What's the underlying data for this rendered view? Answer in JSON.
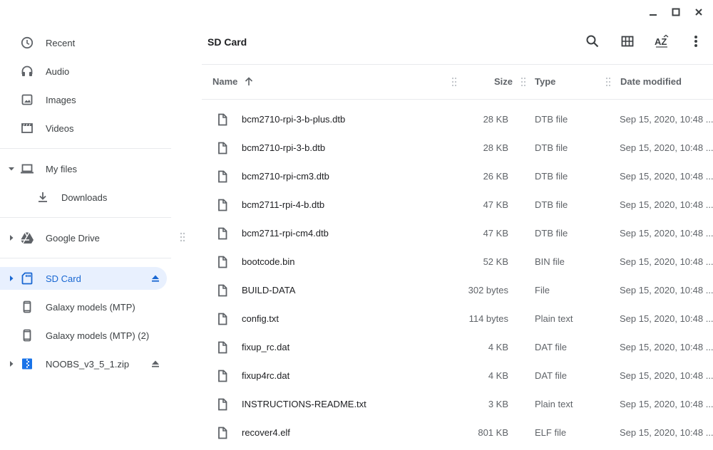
{
  "window": {
    "minimize_icon": "minimize-icon",
    "maximize_icon": "maximize-icon",
    "close_icon": "close-icon"
  },
  "sidebar": {
    "recent": {
      "label": "Recent",
      "icon": "clock-icon"
    },
    "audio": {
      "label": "Audio",
      "icon": "headphones-icon"
    },
    "images": {
      "label": "Images",
      "icon": "image-icon"
    },
    "videos": {
      "label": "Videos",
      "icon": "film-icon"
    },
    "my_files": {
      "label": "My files",
      "icon": "laptop-icon"
    },
    "downloads": {
      "label": "Downloads",
      "icon": "download-icon"
    },
    "google_drive": {
      "label": "Google Drive",
      "icon": "drive-icon"
    },
    "sd_card": {
      "label": "SD Card",
      "icon": "sd-card-icon"
    },
    "galaxy_1": {
      "label": "Galaxy models (MTP)",
      "icon": "phone-icon"
    },
    "galaxy_2": {
      "label": "Galaxy models (MTP) (2)",
      "icon": "phone-icon"
    },
    "noobs": {
      "label": "NOOBS_v3_5_1.zip",
      "icon": "zip-archive-icon"
    }
  },
  "header": {
    "title": "SD Card",
    "toolbar": [
      "search-icon",
      "grid-view-icon",
      "sort-az-icon",
      "more-vert-icon"
    ]
  },
  "table": {
    "columns": {
      "name": "Name",
      "size": "Size",
      "type": "Type",
      "date": "Date modified"
    },
    "sort": "name-ascending",
    "rows": [
      {
        "name": "bcm2710-rpi-3-b-plus.dtb",
        "size": "28 KB",
        "type": "DTB file",
        "date": "Sep 15, 2020, 10:48 ..."
      },
      {
        "name": "bcm2710-rpi-3-b.dtb",
        "size": "28 KB",
        "type": "DTB file",
        "date": "Sep 15, 2020, 10:48 ..."
      },
      {
        "name": "bcm2710-rpi-cm3.dtb",
        "size": "26 KB",
        "type": "DTB file",
        "date": "Sep 15, 2020, 10:48 ..."
      },
      {
        "name": "bcm2711-rpi-4-b.dtb",
        "size": "47 KB",
        "type": "DTB file",
        "date": "Sep 15, 2020, 10:48 ..."
      },
      {
        "name": "bcm2711-rpi-cm4.dtb",
        "size": "47 KB",
        "type": "DTB file",
        "date": "Sep 15, 2020, 10:48 ..."
      },
      {
        "name": "bootcode.bin",
        "size": "52 KB",
        "type": "BIN file",
        "date": "Sep 15, 2020, 10:48 ..."
      },
      {
        "name": "BUILD-DATA",
        "size": "302 bytes",
        "type": "File",
        "date": "Sep 15, 2020, 10:48 ..."
      },
      {
        "name": "config.txt",
        "size": "114 bytes",
        "type": "Plain text",
        "date": "Sep 15, 2020, 10:48 ..."
      },
      {
        "name": "fixup_rc.dat",
        "size": "4 KB",
        "type": "DAT file",
        "date": "Sep 15, 2020, 10:48 ..."
      },
      {
        "name": "fixup4rc.dat",
        "size": "4 KB",
        "type": "DAT file",
        "date": "Sep 15, 2020, 10:48 ..."
      },
      {
        "name": "INSTRUCTIONS-README.txt",
        "size": "3 KB",
        "type": "Plain text",
        "date": "Sep 15, 2020, 10:48 ..."
      },
      {
        "name": "recover4.elf",
        "size": "801 KB",
        "type": "ELF file",
        "date": "Sep 15, 2020, 10:48 ..."
      }
    ]
  },
  "colors": {
    "accent": "#1967d2",
    "selected_bg": "#e8f0fe",
    "icon_gray": "#5f6368",
    "divider": "#e8eaed"
  }
}
